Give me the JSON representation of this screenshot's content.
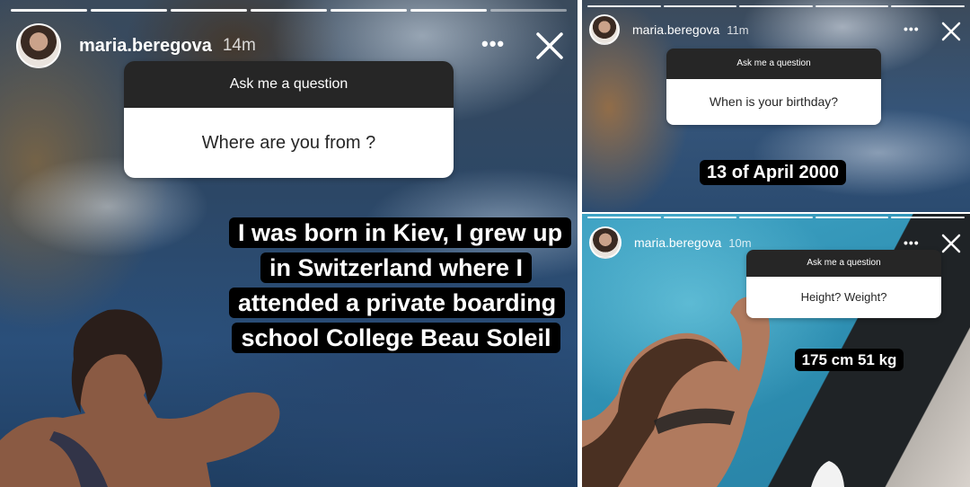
{
  "stories": [
    {
      "username": "maria.beregova",
      "time": "14m",
      "question_header": "Ask me a question",
      "question": "Where are you from ?",
      "answer": "I was born in Kiev, I grew up in Switzerland where I attended a private boarding school College Beau Soleil",
      "progress_segments": 7,
      "progress_done": 6
    },
    {
      "username": "maria.beregova",
      "time": "11m",
      "question_header": "Ask me a question",
      "question": "When is your birthday?",
      "answer": "13 of April 2000",
      "progress_segments": 5,
      "progress_done": 5
    },
    {
      "username": "maria.beregova",
      "time": "10m",
      "question_header": "Ask me a question",
      "question": "Height? Weight?",
      "answer": "175 cm 51 kg",
      "progress_segments": 5,
      "progress_done": 5
    }
  ],
  "icons": {
    "more": "more-horizontal-icon",
    "close": "close-icon"
  },
  "colors": {
    "sticker_header": "#262626",
    "sticker_body": "#ffffff",
    "answer_highlight": "#000000"
  }
}
